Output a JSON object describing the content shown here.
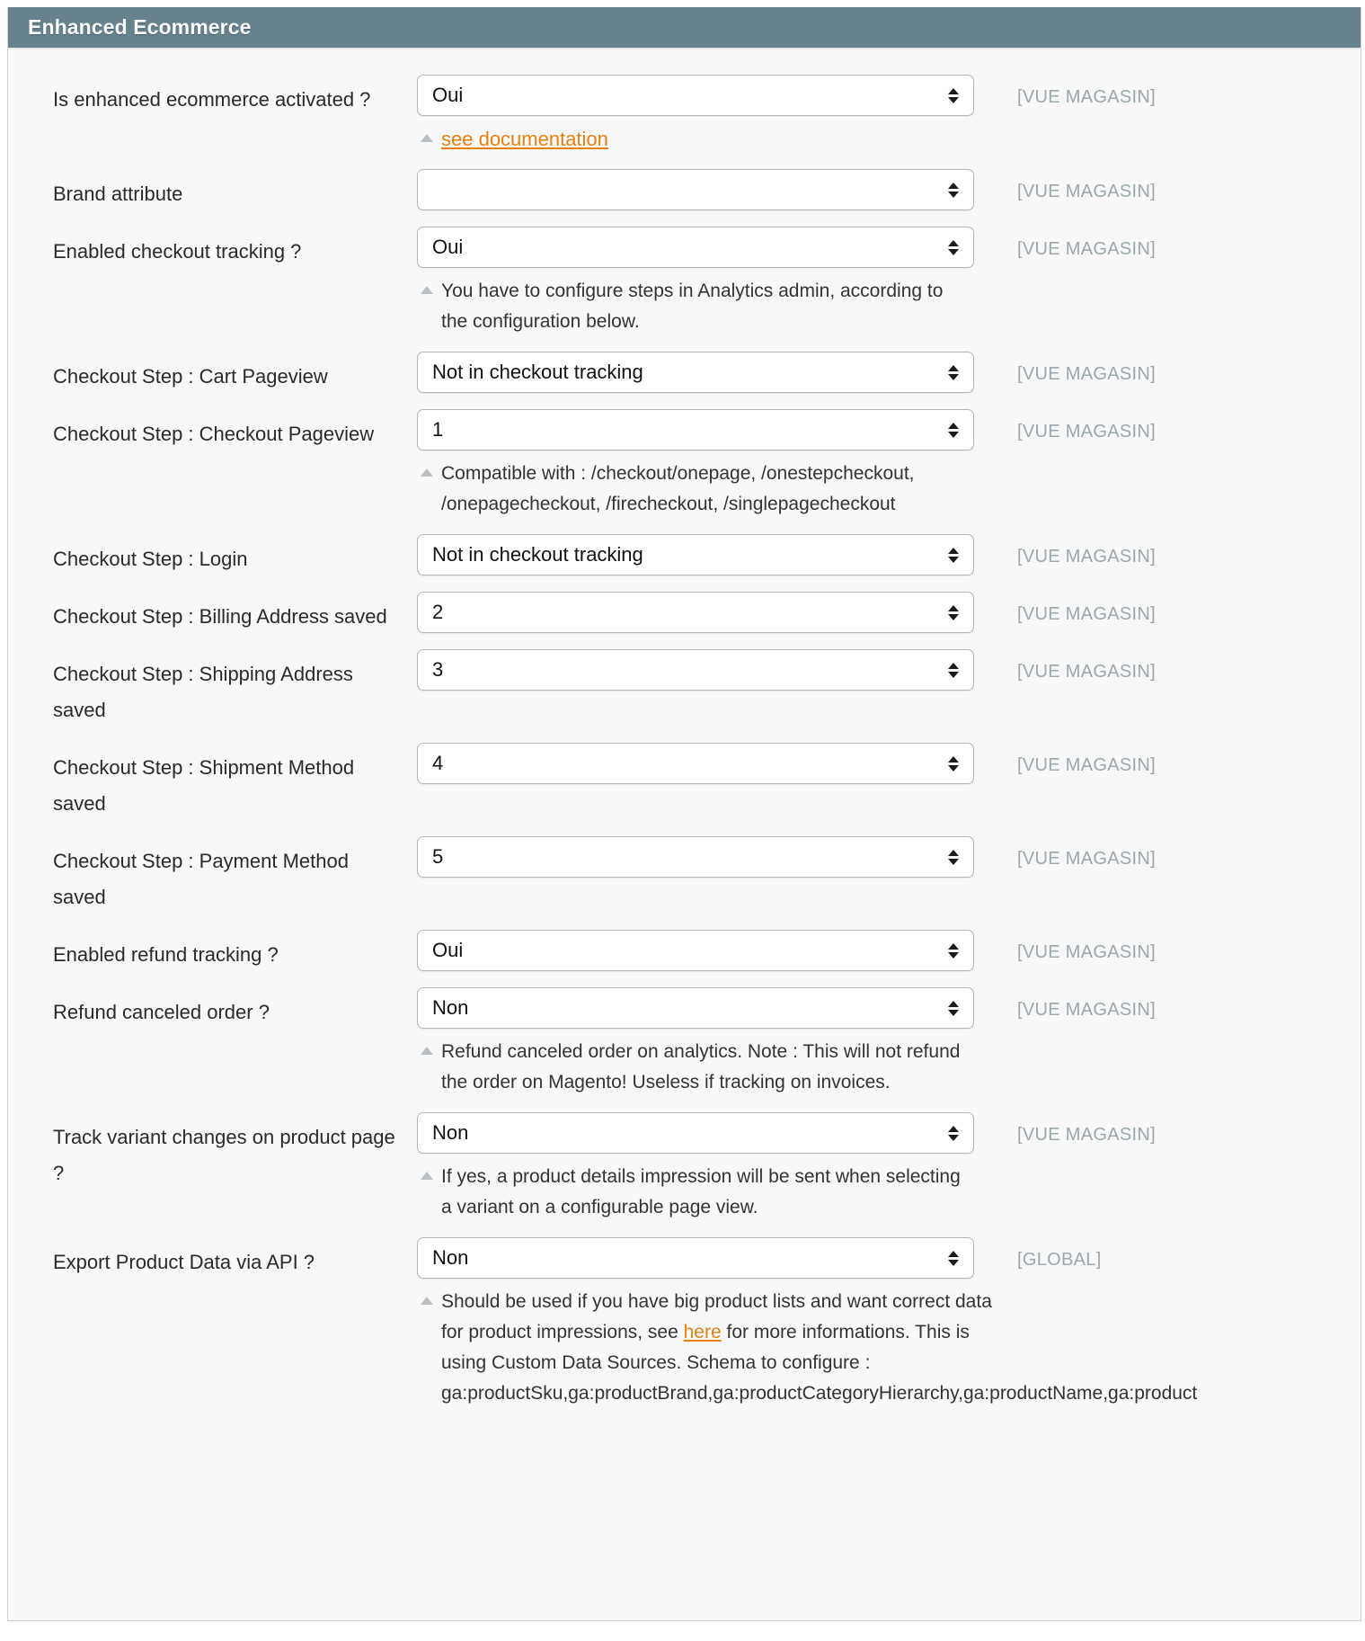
{
  "panel": {
    "title": "Enhanced Ecommerce",
    "accent_header_color": "#67828d",
    "link_color": "#e8800f",
    "scope_color": "#9aa7ad"
  },
  "scopes": {
    "store_view": "[VUE MAGASIN]",
    "global": "[GLOBAL]"
  },
  "fields": [
    {
      "label": "Is enhanced ecommerce activated ?",
      "value": "Oui",
      "scope": "[VUE MAGASIN]",
      "note_prefix": "",
      "note_link": "see documentation",
      "note_suffix": ""
    },
    {
      "label": "Brand attribute",
      "value": "",
      "scope": "[VUE MAGASIN]"
    },
    {
      "label": "Enabled checkout tracking ?",
      "value": "Oui",
      "scope": "[VUE MAGASIN]",
      "note": "You have to configure steps in Analytics admin, according to the configuration below."
    },
    {
      "label": "Checkout Step : Cart Pageview",
      "value": "Not in checkout tracking",
      "scope": "[VUE MAGASIN]"
    },
    {
      "label": "Checkout Step : Checkout Pageview",
      "value": "1",
      "scope": "[VUE MAGASIN]",
      "note": "Compatible with : /checkout/onepage, /onestepcheckout, /onepagecheckout, /firecheckout, /singlepagecheckout"
    },
    {
      "label": "Checkout Step : Login",
      "value": "Not in checkout tracking",
      "scope": "[VUE MAGASIN]"
    },
    {
      "label": "Checkout Step : Billing Address saved",
      "value": "2",
      "scope": "[VUE MAGASIN]"
    },
    {
      "label": "Checkout Step : Shipping Address saved",
      "value": "3",
      "scope": "[VUE MAGASIN]"
    },
    {
      "label": "Checkout Step : Shipment Method saved",
      "value": "4",
      "scope": "[VUE MAGASIN]"
    },
    {
      "label": "Checkout Step : Payment Method saved",
      "value": "5",
      "scope": "[VUE MAGASIN]"
    },
    {
      "label": "Enabled refund tracking ?",
      "value": "Oui",
      "scope": "[VUE MAGASIN]"
    },
    {
      "label": "Refund canceled order ?",
      "value": "Non",
      "scope": "[VUE MAGASIN]",
      "note": "Refund canceled order on analytics. Note : This will not refund the order on Magento! Useless if tracking on invoices."
    },
    {
      "label": "Track variant changes on product page ?",
      "value": "Non",
      "scope": "[VUE MAGASIN]",
      "note": "If yes, a product details impression will be sent when selecting a variant on a configurable page view."
    },
    {
      "label": "Export Product Data via API ?",
      "value": "Non",
      "scope": "[GLOBAL]",
      "note_part1": "Should be used if you have big product lists and want correct data for product impressions, see ",
      "note_link": "here",
      "note_part2": " for more informations. This is using Custom Data Sources. Schema to configure :",
      "note_schema": "ga:productSku,ga:productBrand,ga:productCategoryHierarchy,ga:productName,ga:product"
    }
  ]
}
